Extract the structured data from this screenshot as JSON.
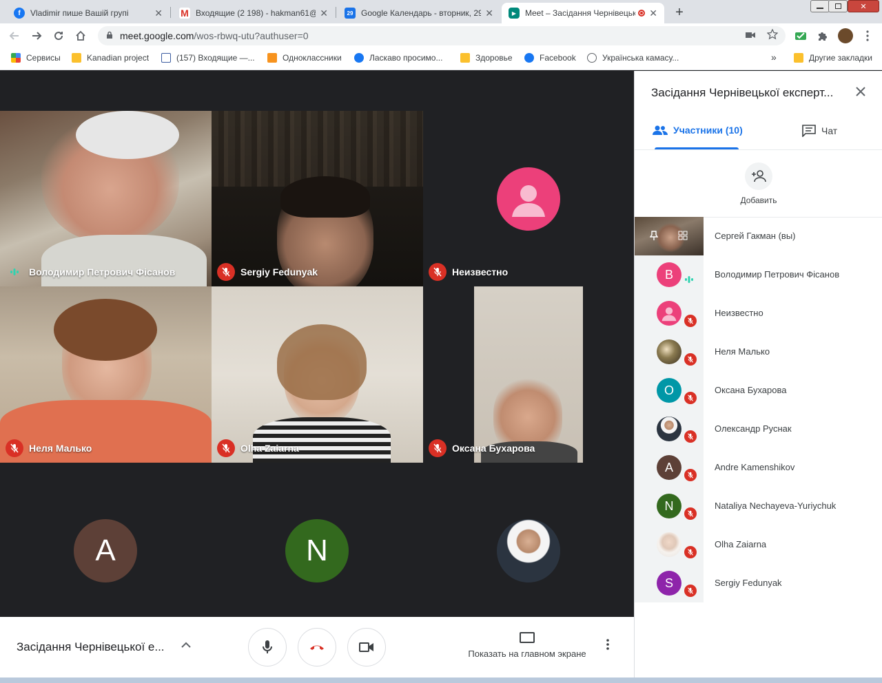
{
  "browser": {
    "tabs": [
      {
        "title": "Vladimir пише Вашій групі",
        "favicon": "facebook-icon",
        "color": "#1877f2",
        "glyph": "f"
      },
      {
        "title": "Входящие (2 198) - hakman61@",
        "favicon": "gmail-icon",
        "color": "#d93025",
        "glyph": "M"
      },
      {
        "title": "Google Календарь - вторник, 29",
        "favicon": "calendar-icon",
        "color": "#1a73e8",
        "glyph": "29"
      },
      {
        "title": "Meet – Засідання Чернівецьк",
        "favicon": "meet-icon",
        "color": "#00897b",
        "glyph": "▶"
      }
    ],
    "close_glyph": "✕",
    "new_tab_glyph": "+",
    "url_host": "meet.google.com",
    "url_path": "/wos-rbwq-utu?authuser=0",
    "bookmarks": [
      {
        "label": "Сервисы",
        "icon": "apps"
      },
      {
        "label": "Kanadian project",
        "icon": "folder"
      },
      {
        "label": "(157) Входящие —...",
        "icon": "mail"
      },
      {
        "label": "Одноклассники",
        "icon": "ok"
      },
      {
        "label": "Ласкаво просимо...",
        "icon": "fb"
      },
      {
        "label": "Здоровье",
        "icon": "folder"
      },
      {
        "label": "Facebook",
        "icon": "fb"
      },
      {
        "label": "Українська камасу...",
        "icon": "globe"
      }
    ],
    "bookmarks_overflow": "»",
    "other_bookmarks": "Другие закладки"
  },
  "meet": {
    "tiles": [
      {
        "name": "Володимир Петрович Фісанов",
        "state": "speaking"
      },
      {
        "name": "Sergiy Fedunyak",
        "state": "muted"
      },
      {
        "name": "Неизвестно",
        "state": "muted"
      },
      {
        "name": "Неля Малько",
        "state": "muted"
      },
      {
        "name": "Olha Zaiarna",
        "state": "muted"
      },
      {
        "name": "Оксана Бухарова",
        "state": "muted"
      }
    ],
    "bottom_avatars": [
      {
        "letter": "A",
        "color": "#5d4037"
      },
      {
        "letter": "N",
        "color": "#33691e"
      }
    ],
    "controls": {
      "meeting_title": "Засідання Чернівецької е...",
      "present_label": "Показать на главном экране"
    }
  },
  "panel": {
    "title": "Засідання Чернівецької експерт...",
    "tab_participants": "Участники (10)",
    "tab_chat": "Чат",
    "add_label": "Добавить",
    "participants": [
      {
        "name": "Сергей Гакман (вы)",
        "avatar": "video",
        "letter": "",
        "color": "#6b5a4a",
        "state": "self"
      },
      {
        "name": "Володимир Петрович Фісанов",
        "avatar": "letter",
        "letter": "В",
        "color": "#ec407a",
        "state": "speaking"
      },
      {
        "name": "Неизвестно",
        "avatar": "person",
        "letter": "",
        "color": "#ec407a",
        "state": "muted"
      },
      {
        "name": "Неля Малько",
        "avatar": "photo",
        "letter": "",
        "color": "#7a6a4a",
        "state": "muted"
      },
      {
        "name": "Оксана Бухарова",
        "avatar": "letter",
        "letter": "О",
        "color": "#0097a7",
        "state": "muted"
      },
      {
        "name": "Олександр Руснак",
        "avatar": "photo",
        "letter": "",
        "color": "#37474f",
        "state": "muted"
      },
      {
        "name": "Andre Kamenshikov",
        "avatar": "letter",
        "letter": "A",
        "color": "#5d4037",
        "state": "muted"
      },
      {
        "name": "Nataliya Nechayeva-Yuriychuk",
        "avatar": "letter",
        "letter": "N",
        "color": "#33691e",
        "state": "muted"
      },
      {
        "name": "Olha Zaiarna",
        "avatar": "photo",
        "letter": "",
        "color": "#e0d6cc",
        "state": "muted"
      },
      {
        "name": "Sergiy Fedunyak",
        "avatar": "letter",
        "letter": "S",
        "color": "#8e24aa",
        "state": "muted"
      }
    ]
  },
  "colors": {
    "accent": "#1a73e8",
    "mute_red": "#d93025",
    "speaking_teal": "#2fd3b0",
    "meet_bg": "#202124"
  }
}
